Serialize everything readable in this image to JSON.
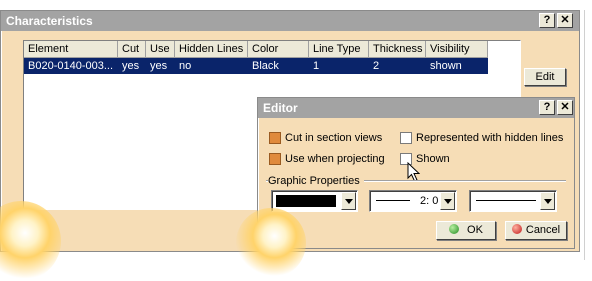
{
  "characteristics": {
    "title": "Characteristics",
    "help_label": "?",
    "close_label": "✕",
    "columns": [
      "Element",
      "Cut",
      "Use",
      "Hidden Lines",
      "Color",
      "Line Type",
      "Thickness",
      "Visibility"
    ],
    "row": [
      "B020-0140-003...",
      "yes",
      "yes",
      "no",
      "Black",
      "1",
      "2",
      "shown"
    ],
    "edit_label": "Edit"
  },
  "editor": {
    "title": "Editor",
    "help_label": "?",
    "close_label": "✕",
    "options": [
      {
        "label": "Cut in section views",
        "checked": true
      },
      {
        "label": "Represented with hidden lines",
        "checked": false
      },
      {
        "label": "Use when projecting",
        "checked": true
      },
      {
        "label": "Shown",
        "checked": false
      }
    ],
    "group_label": "Graphic Properties",
    "color_value": "Black",
    "line_type_value": "2: 0",
    "ok_label": "OK",
    "cancel_label": "Cancel"
  },
  "colors": {
    "accent_bg": "#f6ddb6",
    "title_bg": "#a3a3a3",
    "selection": "#0a246a",
    "checked": "#e08a3c"
  }
}
